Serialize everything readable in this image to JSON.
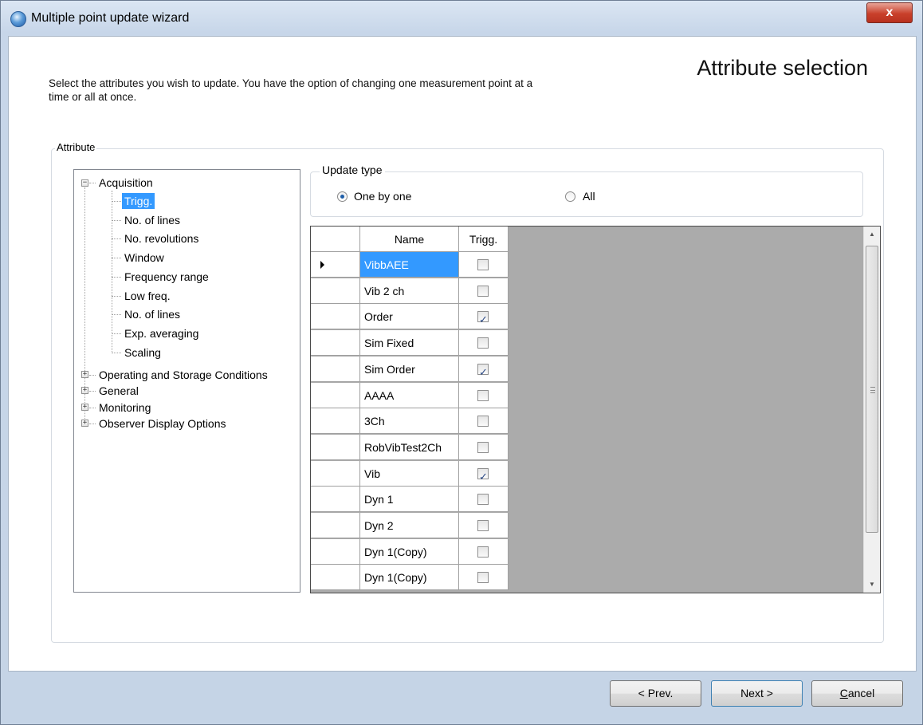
{
  "window": {
    "title": "Multiple point update wizard",
    "close_label": "x"
  },
  "page": {
    "heading": "Attribute selection",
    "description": "Select the attributes you wish to update. You have the option of changing one measurement point at a time or all at once."
  },
  "attribute_group": {
    "caption": "Attribute"
  },
  "tree": {
    "acquisition": {
      "label": "Acquisition",
      "expander": "−",
      "children": [
        "Trigg.",
        "No. of lines",
        "No. revolutions",
        "Window",
        "Frequency range",
        "Low freq.",
        "No. of lines",
        "Exp. averaging",
        "Scaling"
      ],
      "selected": "Trigg."
    },
    "collapsed": [
      {
        "label": "Operating and Storage Conditions",
        "expander": "+"
      },
      {
        "label": "General",
        "expander": "+"
      },
      {
        "label": "Monitoring",
        "expander": "+"
      },
      {
        "label": "Observer Display Options",
        "expander": "+"
      }
    ]
  },
  "update_type": {
    "caption": "Update type",
    "options": [
      {
        "label": "One by one",
        "checked": true
      },
      {
        "label": "All",
        "checked": false
      }
    ]
  },
  "grid": {
    "columns": [
      "Name",
      "Trigg."
    ],
    "rows": [
      {
        "name": "VibbAEE",
        "trigg": false,
        "current": true
      },
      {
        "name": "Vib 2 ch",
        "trigg": false
      },
      {
        "name": "Order",
        "trigg": true
      },
      {
        "name": "Sim Fixed",
        "trigg": false
      },
      {
        "name": "Sim Order",
        "trigg": true
      },
      {
        "name": "AAAA",
        "trigg": false
      },
      {
        "name": "3Ch",
        "trigg": false
      },
      {
        "name": "RobVibTest2Ch",
        "trigg": false
      },
      {
        "name": "Vib",
        "trigg": true
      },
      {
        "name": "Dyn 1",
        "trigg": false
      },
      {
        "name": "Dyn 2",
        "trigg": false
      },
      {
        "name": "Dyn 1(Copy)",
        "trigg": false
      },
      {
        "name": "Dyn 1(Copy)",
        "trigg": false
      }
    ]
  },
  "buttons": {
    "prev": "< Prev.",
    "next": "Next >",
    "cancel": "Cancel"
  }
}
